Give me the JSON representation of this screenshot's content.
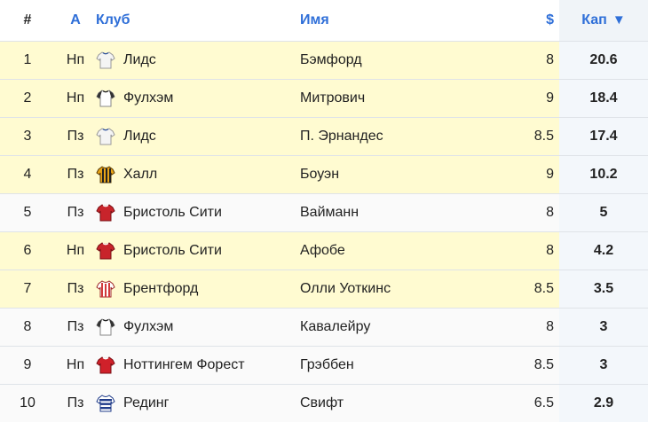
{
  "headers": {
    "num": "#",
    "pos": "A",
    "club": "Клуб",
    "name": "Имя",
    "price": "$",
    "kap": "Кап",
    "sort_icon": "▼"
  },
  "colors": {
    "highlight": "#fffbd1",
    "header_text": "#2f6fd8"
  },
  "rows": [
    {
      "num": "1",
      "pos": "Нп",
      "club": "Лидс",
      "name": "Бэмфорд",
      "price": "8",
      "kap": "20.6",
      "highlight": true,
      "shirt": "leeds"
    },
    {
      "num": "2",
      "pos": "Нп",
      "club": "Фулхэм",
      "name": "Митрович",
      "price": "9",
      "kap": "18.4",
      "highlight": true,
      "shirt": "fulham"
    },
    {
      "num": "3",
      "pos": "Пз",
      "club": "Лидс",
      "name": "П. Эрнандес",
      "price": "8.5",
      "kap": "17.4",
      "highlight": true,
      "shirt": "leeds"
    },
    {
      "num": "4",
      "pos": "Пз",
      "club": "Халл",
      "name": "Боуэн",
      "price": "9",
      "kap": "10.2",
      "highlight": true,
      "shirt": "hull"
    },
    {
      "num": "5",
      "pos": "Пз",
      "club": "Бристоль Сити",
      "name": "Вайманн",
      "price": "8",
      "kap": "5",
      "highlight": false,
      "shirt": "bristol"
    },
    {
      "num": "6",
      "pos": "Нп",
      "club": "Бристоль Сити",
      "name": "Афобе",
      "price": "8",
      "kap": "4.2",
      "highlight": true,
      "shirt": "bristol"
    },
    {
      "num": "7",
      "pos": "Пз",
      "club": "Брентфорд",
      "name": "Олли Уоткинс",
      "price": "8.5",
      "kap": "3.5",
      "highlight": true,
      "shirt": "brentford"
    },
    {
      "num": "8",
      "pos": "Пз",
      "club": "Фулхэм",
      "name": "Кавалейру",
      "price": "8",
      "kap": "3",
      "highlight": false,
      "shirt": "fulham"
    },
    {
      "num": "9",
      "pos": "Нп",
      "club": "Ноттингем Форест",
      "name": "Грэббен",
      "price": "8.5",
      "kap": "3",
      "highlight": false,
      "shirt": "forest"
    },
    {
      "num": "10",
      "pos": "Пз",
      "club": "Рединг",
      "name": "Свифт",
      "price": "6.5",
      "kap": "2.9",
      "highlight": false,
      "shirt": "reading"
    }
  ]
}
